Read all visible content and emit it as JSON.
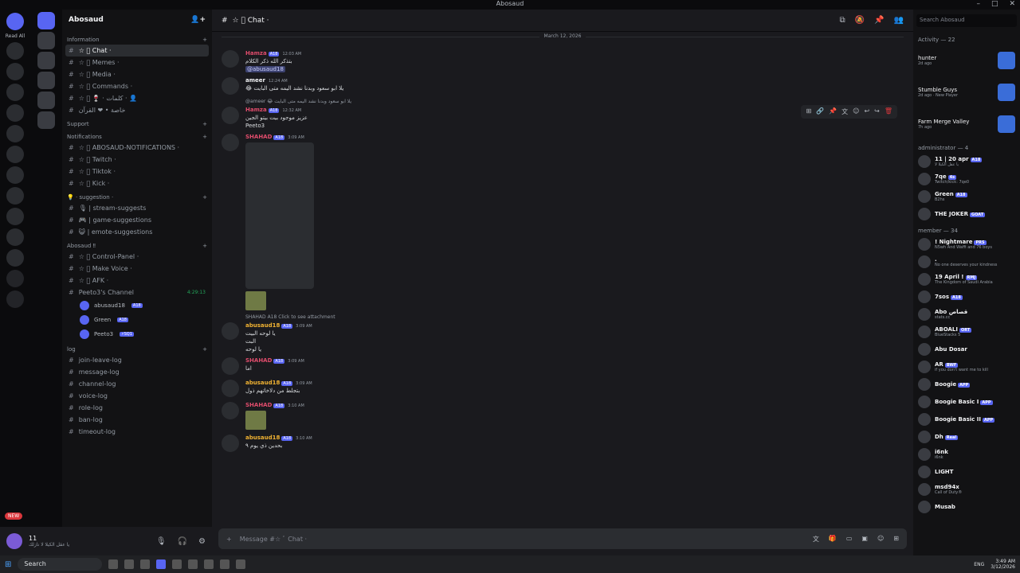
{
  "window": {
    "title": "Abosaud"
  },
  "rail": {
    "read_all": "Read All"
  },
  "sidebar": {
    "server_name": "Abosaud",
    "categories": [
      {
        "name": "Information",
        "channels": [
          {
            "name": "☆ ﾞ Chat ·",
            "active": true
          },
          {
            "name": "☆ ﾞ Memes ·"
          },
          {
            "name": "☆ ﾞ Media ·"
          },
          {
            "name": "☆ ﾞ Commands ·"
          },
          {
            "name": "☆ ﾞ 🍷 · كلمات · 👤"
          },
          {
            "name": "خاصة • ❤ القرآن"
          }
        ]
      },
      {
        "name": "Support",
        "channels": []
      },
      {
        "name": "Notifications",
        "channels": [
          {
            "name": "☆ ﾞ ABOSAUD-NOTIFICATIONS ·"
          },
          {
            "name": "☆ ﾞ Twitch ·"
          },
          {
            "name": "☆ ﾞ Tiktok ·"
          },
          {
            "name": "☆ ﾞ Kick ·"
          }
        ]
      },
      {
        "name": "💡 · suggestion ·",
        "channels": [
          {
            "name": "🎙 | stream-suggests"
          },
          {
            "name": "🎮 | game-suggestions"
          },
          {
            "name": "😺 | emote-suggestions"
          }
        ]
      },
      {
        "name": "Abosaud ‼",
        "channels": [
          {
            "name": "☆ ﾞ Control-Panel ·"
          },
          {
            "name": "☆ ﾞ Make Voice ·"
          },
          {
            "name": "☆ ﾞ AFK ·"
          },
          {
            "name": "Peeto3's Channel",
            "time": "4:29:13"
          }
        ]
      }
    ],
    "voice_users": [
      {
        "name": "abusaud18",
        "tag": "A18"
      },
      {
        "name": "Green",
        "tag": "A18"
      },
      {
        "name": "Peeto3",
        "tag": "⚡SQ1"
      }
    ],
    "log_category": "log",
    "log_channels": [
      "join-leave-log",
      "message-log",
      "channel-log",
      "voice-log",
      "role-log",
      "ban-log",
      "timeout-log"
    ]
  },
  "userbar": {
    "name": "11",
    "status": "يا عقل الكيلا لا نازلك",
    "new_label": "NEW"
  },
  "chat": {
    "channel": "☆ ﾞ Chat ·",
    "date_divider": "March 12, 2026",
    "messages": [
      {
        "user": "Hamza",
        "tag": "A18",
        "time": "12:03 AM",
        "color": "#e04c6c",
        "text": "بتذكر الله ذكر الكلام",
        "mention": "@abusaud18"
      },
      {
        "user": "ameer",
        "tag": "",
        "time": "12:24 AM",
        "color": "#f2f3f5",
        "text": "😂 يلا ابو سعود وبدنا نشد اليمه متى البايت"
      },
      {
        "reply": "@ameer 😂 يلا ابو سعود وبدنا نشد اليمه متى البايت",
        "user": "Hamza",
        "tag": "A18",
        "time": "12:32 AM",
        "color": "#e04c6c",
        "text": "عزيز موجود بيت بيتو الجين",
        "text2": "Peeto3"
      },
      {
        "user": "SHAHAD",
        "tag": "A18",
        "time": "3:09 AM",
        "color": "#e04c6c",
        "image": true
      },
      {
        "reply": "SHAHAD  A18  Click to see attachment",
        "user": "abusaud18",
        "tag": "A18",
        "time": "3:09 AM",
        "color": "#f0b232",
        "text": "يا لوحه البيت",
        "text2": "البت",
        "text3": "يا لوحه"
      },
      {
        "user": "SHAHAD",
        "tag": "A18",
        "time": "3:09 AM",
        "color": "#e04c6c",
        "text": "اما"
      },
      {
        "user": "abusaud18",
        "tag": "A18",
        "time": "3:09 AM",
        "color": "#f0b232",
        "text": "بتجلط من دلاخاتهم ذول"
      },
      {
        "user": "SHAHAD",
        "tag": "A18",
        "time": "3:10 AM",
        "color": "#e04c6c",
        "thumb": true
      },
      {
        "user": "abusaud18",
        "tag": "A18",
        "time": "3:10 AM",
        "color": "#f0b232",
        "text": "بحدين ذي يوم ٩"
      }
    ],
    "input_placeholder": "Message #☆ ﾞ Chat ·"
  },
  "members": {
    "search_placeholder": "Search Abosaud",
    "activity_header": "Activity — 22",
    "activities": [
      {
        "game": "hunter",
        "ago": "2d ago"
      },
      {
        "game": "Stumble Guys",
        "ago": "2d ago",
        "extra": "New Player"
      },
      {
        "game": "Farm Merge Valley",
        "ago": "7h ago"
      }
    ],
    "admin_header": "administrator — 4",
    "admins": [
      {
        "name": "11 | 20 apr",
        "tag": "A18",
        "status": "يا عقل الكيلا لا"
      },
      {
        "name": "7qe",
        "tag": "4s",
        "status": "Twitch/kick: 7qe0"
      },
      {
        "name": "Green",
        "tag": "A18",
        "status": "B2hs"
      },
      {
        "name": "THE JOKER",
        "tag": "GOAT",
        "status": ""
      }
    ],
    "member_header": "member — 34",
    "members": [
      {
        "name": "! Nightmare",
        "tag": "PRS",
        "status": "N5wh And Waffi and 76 boys"
      },
      {
        "name": ".",
        "tag": "",
        "status": "No one deserves your kindness"
      },
      {
        "name": "19 April !",
        "tag": "RMJ",
        "status": "The Kingdom of Saudi Arabia"
      },
      {
        "name": "7sos",
        "tag": "A18",
        "status": ""
      },
      {
        "name": "Abo قصاص",
        "tag": "",
        "status": "stats.cc"
      },
      {
        "name": "ABOALI",
        "tag": "ORT",
        "status": "BlueStacks 5"
      },
      {
        "name": "Abu Dosar",
        "tag": "",
        "status": ""
      },
      {
        "name": "AR",
        "tag": "BWF",
        "status": "if you don't want me to kill"
      },
      {
        "name": "Boogie",
        "tag": "APP",
        "status": ""
      },
      {
        "name": "Boogie Basic I",
        "tag": "APP",
        "status": ""
      },
      {
        "name": "Boogie Basic II",
        "tag": "APP",
        "status": ""
      },
      {
        "name": "Dh",
        "tag": "Real",
        "status": ""
      },
      {
        "name": "i6nk",
        "tag": "",
        "status": "i6nk"
      },
      {
        "name": "LIGHT",
        "tag": "",
        "status": ""
      },
      {
        "name": "msd94x",
        "tag": "",
        "status": "Call of Duty®"
      },
      {
        "name": "Musab",
        "tag": "",
        "status": ""
      }
    ]
  },
  "taskbar": {
    "search": "Search",
    "lang": "ENG",
    "time": "3:49 AM",
    "date": "3/12/2026"
  }
}
